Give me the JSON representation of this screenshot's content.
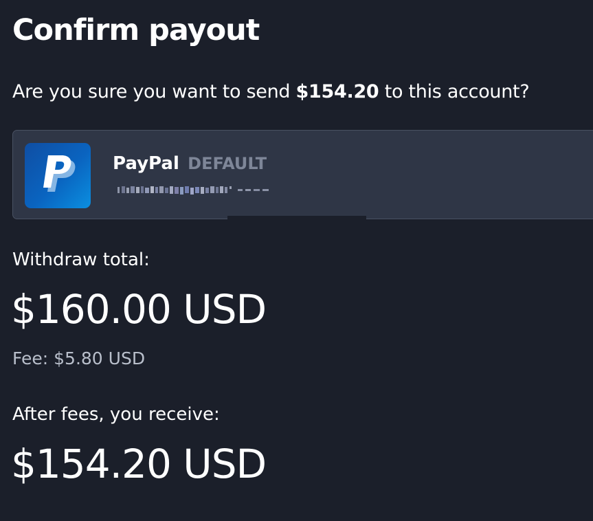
{
  "dialog": {
    "title": "Confirm payout",
    "question_prefix": "Are you sure you want to send ",
    "question_amount": "$154.20",
    "question_suffix": " to this account?"
  },
  "account": {
    "icon": "paypal-logo-icon",
    "name": "PayPal",
    "badge": "DEFAULT",
    "email_redacted": true
  },
  "summary": {
    "withdraw_label": "Withdraw total:",
    "withdraw_amount": "$160.00 USD",
    "fee_text": "Fee: $5.80 USD",
    "receive_label": "After fees, you receive:",
    "receive_amount": "$154.20 USD"
  },
  "colors": {
    "background": "#1b1f2a",
    "card": "#2f3646",
    "paypal_blue": "#0a64c0",
    "muted": "#7e8698"
  }
}
